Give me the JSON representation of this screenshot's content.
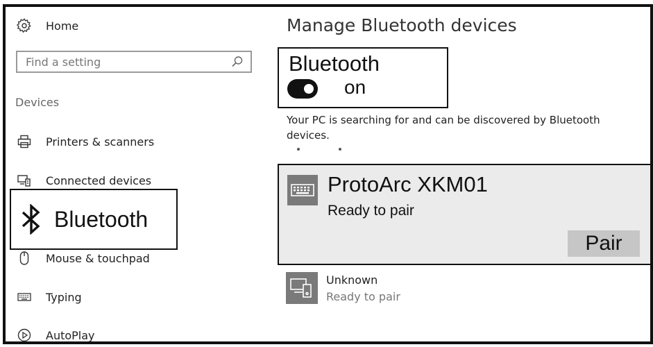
{
  "sidebar": {
    "home_label": "Home",
    "search": {
      "value": "",
      "placeholder": "Find a setting"
    },
    "section_heading": "Devices",
    "items": [
      {
        "label": "Printers & scanners",
        "icon": "printer-icon"
      },
      {
        "label": "Connected devices",
        "icon": "connected-devices-icon"
      },
      {
        "label": "Bluetooth",
        "icon": "bluetooth-icon",
        "selected": true
      },
      {
        "label": "Mouse & touchpad",
        "icon": "mouse-icon"
      },
      {
        "label": "Typing",
        "icon": "keyboard-icon"
      },
      {
        "label": "AutoPlay",
        "icon": "autoplay-icon"
      }
    ]
  },
  "main": {
    "title": "Manage Bluetooth devices",
    "bluetooth": {
      "label": "Bluetooth",
      "state_text": "on",
      "enabled": true
    },
    "description": "Your PC is searching for and can be discovered by Bluetooth devices.",
    "devices": [
      {
        "name": "ProtoArc XKM01",
        "status": "Ready to pair",
        "icon": "keyboard-device-icon",
        "action_label": "Pair",
        "selected": true
      },
      {
        "name": "Unknown",
        "status": "Ready to pair",
        "icon": "unknown-device-icon"
      }
    ]
  },
  "colors": {
    "accent": "#111111",
    "selected_card_bg": "#ebebeb",
    "pair_button_bg": "#c6c6c6",
    "device_icon_bg": "#7a7a7a",
    "muted_text": "#777777"
  }
}
